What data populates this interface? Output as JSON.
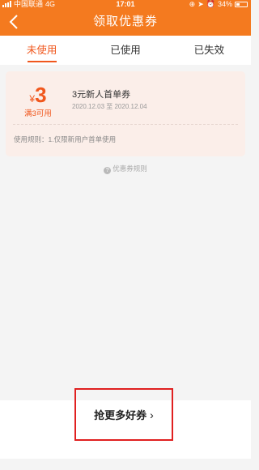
{
  "status_bar": {
    "carrier": "中国联通",
    "network": "4G",
    "time": "17:01",
    "battery": "34%",
    "battery_level": 0.34
  },
  "nav": {
    "title": "领取优惠券",
    "back_icon": "chevron-left-icon"
  },
  "tabs": [
    {
      "label": "未使用",
      "active": true
    },
    {
      "label": "已使用",
      "active": false
    },
    {
      "label": "已失效",
      "active": false
    }
  ],
  "coupon": {
    "currency": "¥",
    "value": "3",
    "condition": "满3可用",
    "name": "3元新人首单券",
    "validity": "2020.12.03 至 2020.12.04",
    "rules": "使用规则：1.仅限新用户首单使用"
  },
  "rules_link": {
    "label": "优惠券规则"
  },
  "bottom": {
    "button_label": "抢更多好券",
    "chevron": "›"
  },
  "colors": {
    "accent": "#f47a1f",
    "highlight": "#f0571d",
    "annotation_box": "#e02020"
  }
}
